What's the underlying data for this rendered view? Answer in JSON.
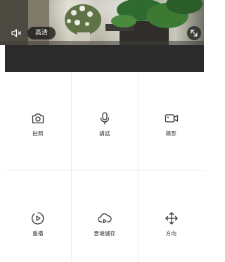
{
  "video": {
    "quality_label": "高清",
    "mute_icon": "speaker-mute-icon",
    "fullscreen_icon": "fullscreen-icon"
  },
  "controls": [
    {
      "label": "拍照",
      "icon": "camera-icon"
    },
    {
      "label": "講話",
      "icon": "microphone-icon"
    },
    {
      "label": "錄影",
      "icon": "video-record-icon"
    },
    {
      "label": "重播",
      "icon": "playback-icon"
    },
    {
      "label": "雲端儲存",
      "icon": "cloud-storage-icon"
    },
    {
      "label": "方向",
      "icon": "direction-icon"
    }
  ]
}
